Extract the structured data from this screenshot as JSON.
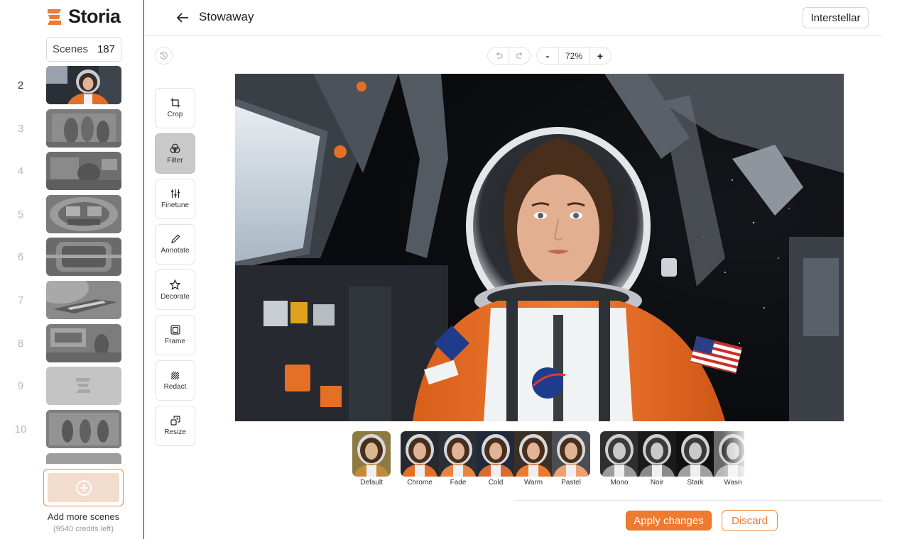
{
  "brand": {
    "name": "Storia",
    "accent": "#ee7b30"
  },
  "sidebar": {
    "scenes_label": "Scenes",
    "scenes_count": "187",
    "scenes": [
      {
        "number": "2",
        "active": true
      },
      {
        "number": "3"
      },
      {
        "number": "4"
      },
      {
        "number": "5"
      },
      {
        "number": "6"
      },
      {
        "number": "7"
      },
      {
        "number": "8"
      },
      {
        "number": "9"
      },
      {
        "number": "10"
      },
      {
        "number": ""
      }
    ],
    "add_label": "Add more scenes",
    "credits": "(9540 credits left)"
  },
  "header": {
    "title": "Stowaway",
    "project": "Interstellar"
  },
  "controls": {
    "zoom": "72%",
    "zoom_out": "-",
    "zoom_in": "+"
  },
  "tools": [
    {
      "label": "Crop",
      "icon": "crop-icon"
    },
    {
      "label": "Filter",
      "icon": "filter-icon",
      "active": true
    },
    {
      "label": "Finetune",
      "icon": "sliders-icon"
    },
    {
      "label": "Annotate",
      "icon": "pencil-icon"
    },
    {
      "label": "Decorate",
      "icon": "star-icon"
    },
    {
      "label": "Frame",
      "icon": "frame-icon"
    },
    {
      "label": "Redact",
      "icon": "redact-icon"
    },
    {
      "label": "Resize",
      "icon": "resize-icon"
    }
  ],
  "filters": [
    {
      "label": "Default"
    },
    {
      "label": "Chrome"
    },
    {
      "label": "Fade"
    },
    {
      "label": "Cold"
    },
    {
      "label": "Warm"
    },
    {
      "label": "Pastel"
    },
    {
      "label": "Mono"
    },
    {
      "label": "Noir"
    },
    {
      "label": "Stark"
    },
    {
      "label": "Wash"
    }
  ],
  "actions": {
    "apply": "Apply changes",
    "discard": "Discard"
  }
}
